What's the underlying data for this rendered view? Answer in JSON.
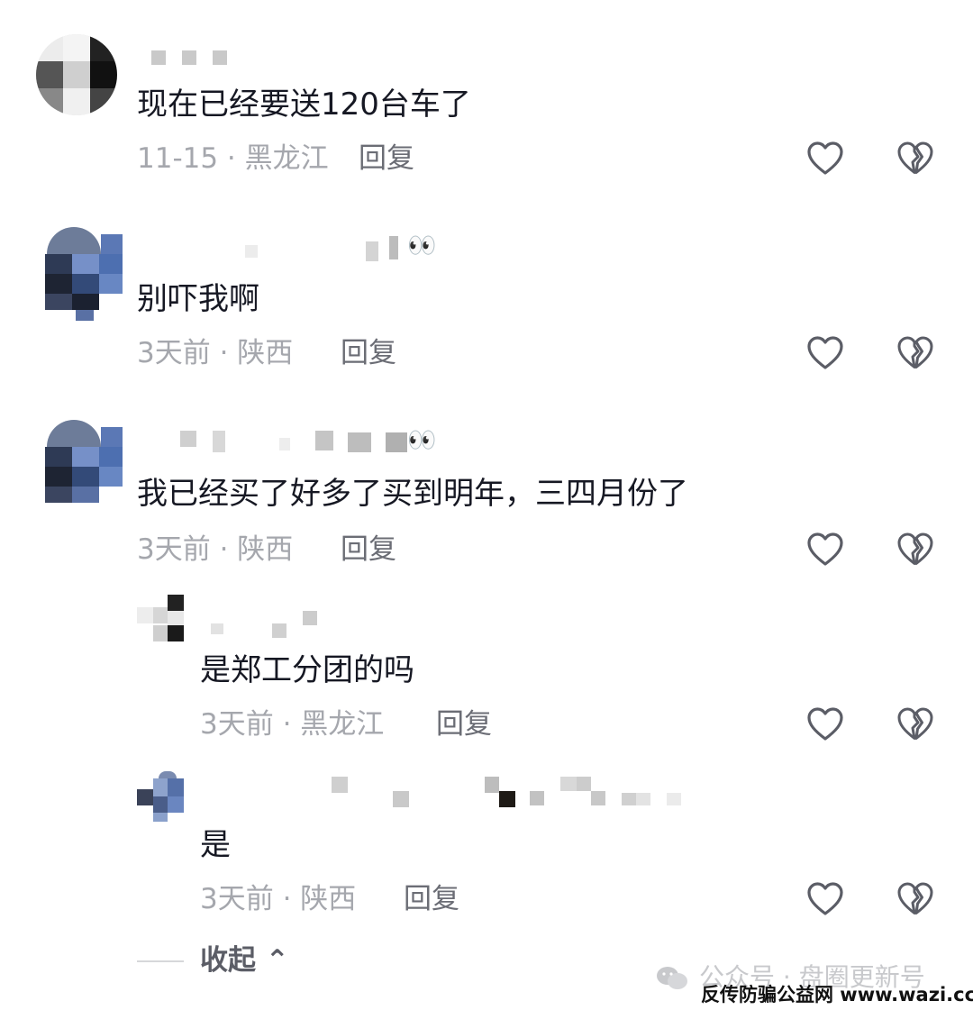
{
  "comments": [
    {
      "text": "现在已经要送120台车了",
      "meta": "11-15 · 黑龙江",
      "reply_label": "回复"
    },
    {
      "text": "别吓我啊",
      "meta": "3天前 · 陕西",
      "reply_label": "回复"
    },
    {
      "text": "我已经买了好多了买到明年，三四月份了",
      "meta": "3天前 · 陕西",
      "reply_label": "回复"
    },
    {
      "text": "是郑工分团的吗",
      "meta": "3天前 · 黑龙江",
      "reply_label": "回复"
    },
    {
      "text": "是",
      "meta": "3天前 · 陕西",
      "reply_label": "回复"
    }
  ],
  "eyes_emoji": "👀",
  "collapse_label": "收起 ⌃",
  "watermark": {
    "line1": "公众号 · 盘圈更新号",
    "line2": "反传防骗公益网 www.wazi.cc"
  },
  "icons": {
    "like": "heart-outline-icon",
    "dislike": "broken-heart-icon",
    "logo": "wechat-icon"
  },
  "colors": {
    "text": "#161823",
    "meta": "#a5a7ad",
    "reply": "#6b6d75",
    "icon": "#5b5d66"
  }
}
